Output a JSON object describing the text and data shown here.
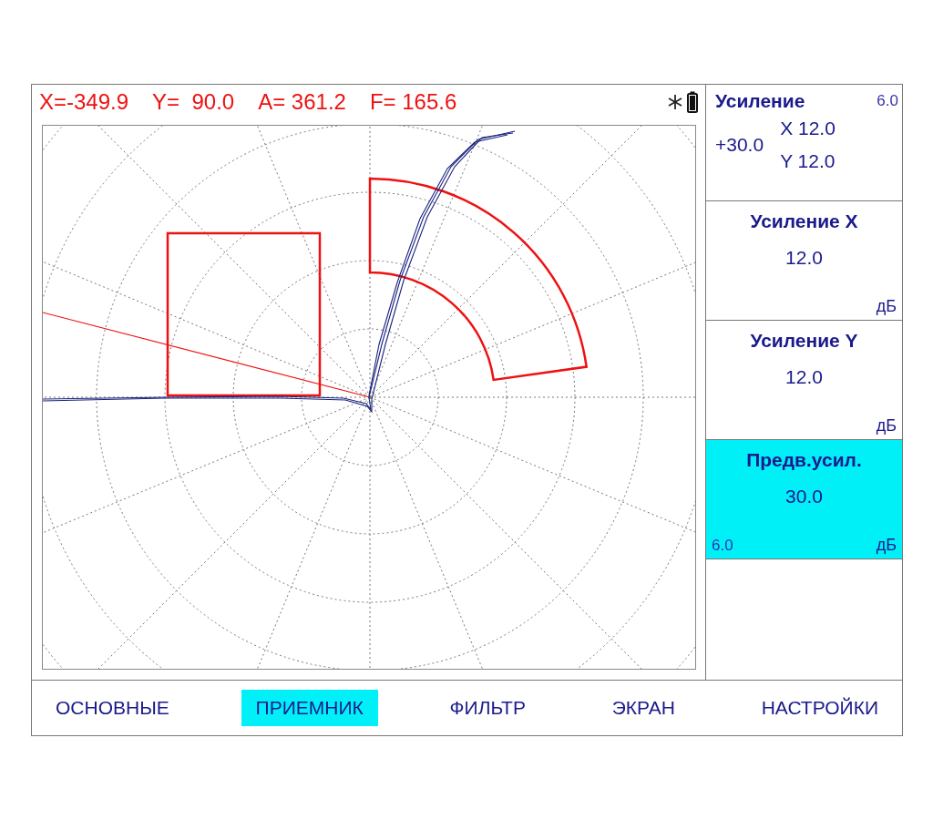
{
  "readout": [
    "X=-349.9",
    "Y=  90.0",
    "A= 361.2",
    "F= 165.6"
  ],
  "panel": {
    "summary": {
      "title": "Усиление",
      "step": "6.0",
      "total": "+30.0",
      "x": "X 12.0",
      "y": "Y 12.0"
    },
    "params": [
      {
        "title": "Усиление X",
        "value": "12.0",
        "unit": "дБ",
        "selected": false
      },
      {
        "title": "Усиление Y",
        "value": "12.0",
        "unit": "дБ",
        "selected": false
      },
      {
        "title": "Предв.усил.",
        "value": "30.0",
        "unit": "дБ",
        "step": "6.0",
        "selected": true
      }
    ]
  },
  "tabs": [
    {
      "label": "ОСНОВНЫЕ",
      "selected": false
    },
    {
      "label": "ПРИЕМНИК",
      "selected": true
    },
    {
      "label": "ФИЛЬТР",
      "selected": false
    },
    {
      "label": "ЭКРАН",
      "selected": false
    },
    {
      "label": "НАСТРОЙКИ",
      "selected": false
    }
  ]
}
